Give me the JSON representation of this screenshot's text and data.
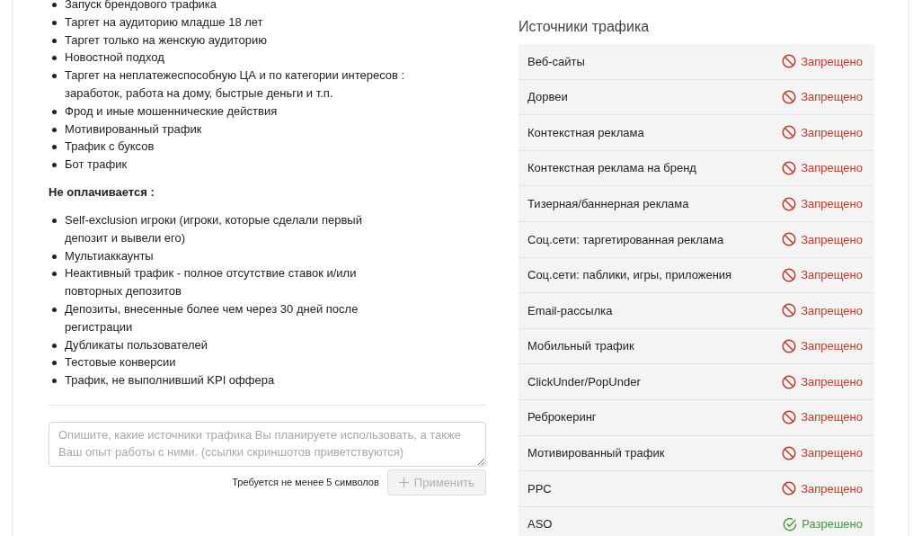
{
  "rules_list": [
    "Запуск брендового трафика",
    "Таргет на аудиторию младше 18 лет",
    "Таргет только на женскую аудиторию",
    "Новостной подход",
    "Таргет на неплатежеспособную ЦА и по категории интересов : заработок, работа на дому, быстрые деньги и т.п.",
    "Фрод и иные мошеннические действия",
    "Мотивированный трафик",
    "Трафик с буксов",
    "Бот трафик"
  ],
  "unpaid": {
    "heading": "Не оплачивается :",
    "items": [
      "Self-exclusion игроки (игроки, которые сделали первый депозит и вывели его)",
      "Мультиаккаунты",
      "Неактивный трафик - полное отсутствие ставок и/или повторных депозитов",
      "Депозиты, внесенные более чем через 30 дней после регистрации",
      "Дубликаты пользователей",
      "Тестовые конверсии",
      "Трафик, не выполнивший KPI оффера"
    ]
  },
  "comment": {
    "placeholder": "Опишите, какие источники трафика Вы планируете использовать, а также Ваш опыт работы с ними. (ссылки скриншотов приветствуются)",
    "hint": "Требуется не менее 5 символов",
    "button": {
      "label": "Применить",
      "disabled": true
    }
  },
  "sources": {
    "title": "Источники трафика",
    "rows": [
      {
        "name": "Веб-сайты",
        "status": "Запрещено",
        "kind": "forbidden"
      },
      {
        "name": "Дорвеи",
        "status": "Запрещено",
        "kind": "forbidden"
      },
      {
        "name": "Контекстная реклама",
        "status": "Запрещено",
        "kind": "forbidden"
      },
      {
        "name": "Контекстная реклама на бренд",
        "status": "Запрещено",
        "kind": "forbidden"
      },
      {
        "name": "Тизерная/баннерная реклама",
        "status": "Запрещено",
        "kind": "forbidden"
      },
      {
        "name": "Соц.сети: таргетированная реклама",
        "status": "Запрещено",
        "kind": "forbidden"
      },
      {
        "name": "Соц.сети: паблики, игры, приложения",
        "status": "Запрещено",
        "kind": "forbidden"
      },
      {
        "name": "Email-рассылка",
        "status": "Запрещено",
        "kind": "forbidden"
      },
      {
        "name": "Мобильный трафик",
        "status": "Запрещено",
        "kind": "forbidden"
      },
      {
        "name": "ClickUnder/PopUnder",
        "status": "Запрещено",
        "kind": "forbidden"
      },
      {
        "name": "Реброкеринг",
        "status": "Запрещено",
        "kind": "forbidden"
      },
      {
        "name": "Мотивированный трафик",
        "status": "Запрещено",
        "kind": "forbidden"
      },
      {
        "name": "PPC",
        "status": "Запрещено",
        "kind": "forbidden"
      },
      {
        "name": "ASO",
        "status": "Разрешено",
        "kind": "allowed"
      }
    ]
  }
}
